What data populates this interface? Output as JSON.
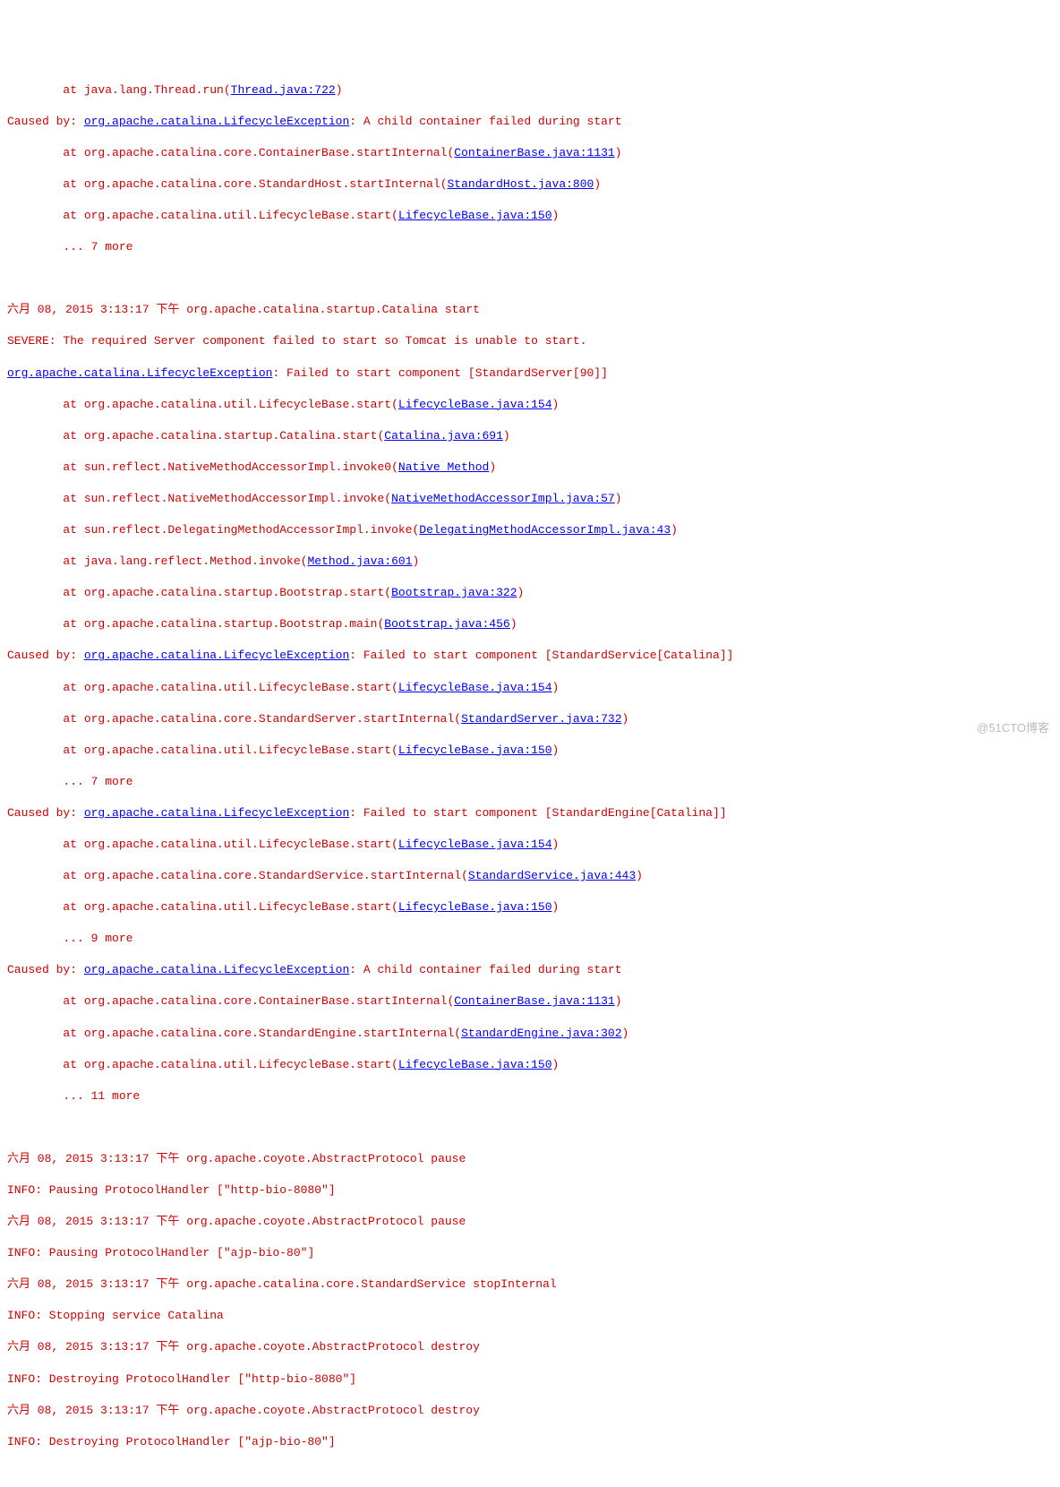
{
  "colors": {
    "error": "#cc0000",
    "link": "#0000ee",
    "text": "#000000"
  },
  "watermark": "@51CTO博客",
  "l": {
    "t1": "        at java.lang.Thread.run",
    "t1a": "(",
    "t1b": "Thread.java:722",
    "t1c": ")",
    "c1": "Caused by: ",
    "c1l": "org.apache.catalina.LifecycleException",
    "c1m": ": A child container failed during start",
    "s1": "        at org.apache.catalina.core.ContainerBase.startInternal",
    "s1o": "(",
    "s1l": "ContainerBase.java:1131",
    "s1c": ")",
    "s2": "        at org.apache.catalina.core.StandardHost.startInternal",
    "s2o": "(",
    "s2l": "StandardHost.java:800",
    "s2c": ")",
    "s3": "        at org.apache.catalina.util.LifecycleBase.start",
    "s3o": "(",
    "s3l": "LifecycleBase.java:150",
    "s3c": ")",
    "m1": "        ... 7 more",
    "h1": "六月 08, 2015 3:13:17 下午 org.apache.catalina.startup.Catalina start",
    "h2": "SEVERE: The required Server component failed to start so Tomcat is unable to start.",
    "h3l": "org.apache.catalina.LifecycleException",
    "h3m": ": Failed to start component [StandardServer[90]]",
    "a1": "        at org.apache.catalina.util.LifecycleBase.start",
    "a1o": "(",
    "a1l": "LifecycleBase.java:154",
    "a1c": ")",
    "a2": "        at org.apache.catalina.startup.Catalina.start",
    "a2o": "(",
    "a2l": "Catalina.java:691",
    "a2c": ")",
    "a3": "        at sun.reflect.NativeMethodAccessorImpl.invoke0",
    "a3o": "(",
    "a3l": "Native Method",
    "a3c": ")",
    "a4": "        at sun.reflect.NativeMethodAccessorImpl.invoke",
    "a4o": "(",
    "a4l": "NativeMethodAccessorImpl.java:57",
    "a4c": ")",
    "a5": "        at sun.reflect.DelegatingMethodAccessorImpl.invoke",
    "a5o": "(",
    "a5l": "DelegatingMethodAccessorImpl.java:43",
    "a5c": ")",
    "a6": "        at java.lang.reflect.Method.invoke",
    "a6o": "(",
    "a6l": "Method.java:601",
    "a6c": ")",
    "a7": "        at org.apache.catalina.startup.Bootstrap.start",
    "a7o": "(",
    "a7l": "Bootstrap.java:322",
    "a7c": ")",
    "a8": "        at org.apache.catalina.startup.Bootstrap.main",
    "a8o": "(",
    "a8l": "Bootstrap.java:456",
    "a8c": ")",
    "c2": "Caused by: ",
    "c2l": "org.apache.catalina.LifecycleException",
    "c2m": ": Failed to start component [StandardService[Catalina]]",
    "b1": "        at org.apache.catalina.util.LifecycleBase.start",
    "b1o": "(",
    "b1l": "LifecycleBase.java:154",
    "b1c": ")",
    "b2": "        at org.apache.catalina.core.StandardServer.startInternal",
    "b2o": "(",
    "b2l": "StandardServer.java:732",
    "b2c": ")",
    "b3": "        at org.apache.catalina.util.LifecycleBase.start",
    "b3o": "(",
    "b3l": "LifecycleBase.java:150",
    "b3c": ")",
    "m2": "        ... 7 more",
    "c3": "Caused by: ",
    "c3l": "org.apache.catalina.LifecycleException",
    "c3m": ": Failed to start component [StandardEngine[Catalina]]",
    "d1": "        at org.apache.catalina.util.LifecycleBase.start",
    "d1o": "(",
    "d1l": "LifecycleBase.java:154",
    "d1c": ")",
    "d2": "        at org.apache.catalina.core.StandardService.startInternal",
    "d2o": "(",
    "d2l": "StandardService.java:443",
    "d2c": ")",
    "d3": "        at org.apache.catalina.util.LifecycleBase.start",
    "d3o": "(",
    "d3l": "LifecycleBase.java:150",
    "d3c": ")",
    "m3": "        ... 9 more",
    "c4": "Caused by: ",
    "c4l": "org.apache.catalina.LifecycleException",
    "c4m": ": A child container failed during start",
    "e1": "        at org.apache.catalina.core.ContainerBase.startInternal",
    "e1o": "(",
    "e1l": "ContainerBase.java:1131",
    "e1c": ")",
    "e2": "        at org.apache.catalina.core.StandardEngine.startInternal",
    "e2o": "(",
    "e2l": "StandardEngine.java:302",
    "e2c": ")",
    "e3": "        at org.apache.catalina.util.LifecycleBase.start",
    "e3o": "(",
    "e3l": "LifecycleBase.java:150",
    "e3c": ")",
    "m4": "        ... 11 more",
    "p1": "六月 08, 2015 3:13:17 下午 org.apache.coyote.AbstractProtocol pause",
    "p2": "INFO: Pausing ProtocolHandler [\"http-bio-8080\"]",
    "p3": "六月 08, 2015 3:13:17 下午 org.apache.coyote.AbstractProtocol pause",
    "p4": "INFO: Pausing ProtocolHandler [\"ajp-bio-80\"]",
    "p5": "六月 08, 2015 3:13:17 下午 org.apache.catalina.core.StandardService stopInternal",
    "p6": "INFO: Stopping service Catalina",
    "p7": "六月 08, 2015 3:13:17 下午 org.apache.coyote.AbstractProtocol destroy",
    "p8": "INFO: Destroying ProtocolHandler [\"http-bio-8080\"]",
    "p9": "六月 08, 2015 3:13:17 下午 org.apache.coyote.AbstractProtocol destroy",
    "p10": "INFO: Destroying ProtocolHandler [\"ajp-bio-80\"]"
  }
}
